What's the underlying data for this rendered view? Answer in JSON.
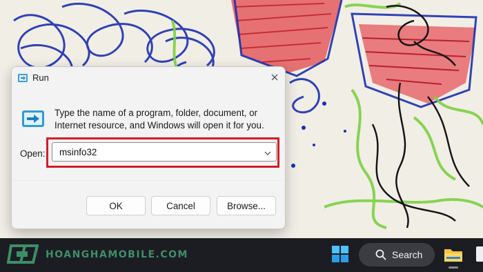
{
  "dialog": {
    "title": "Run",
    "description": "Type the name of a program, folder, document, or Internet resource, and Windows will open it for you.",
    "open_label": "Open:",
    "open_value": "msinfo32",
    "buttons": {
      "ok": "OK",
      "cancel": "Cancel",
      "browse": "Browse..."
    }
  },
  "taskbar": {
    "watermark": "HOANGHAMOBILE.COM",
    "search_label": "Search"
  },
  "colors": {
    "highlight": "#d21c2a",
    "taskbar_bg": "#1c1d22",
    "watermark": "#3d8f6a",
    "wallpaper_blue": "#1c2fb0",
    "wallpaper_red": "#d43038",
    "wallpaper_green": "#7cd142"
  },
  "icons": [
    "run-app-icon",
    "close-icon",
    "chevron-down-icon",
    "windows-start-icon",
    "search-icon",
    "file-explorer-icon"
  ]
}
